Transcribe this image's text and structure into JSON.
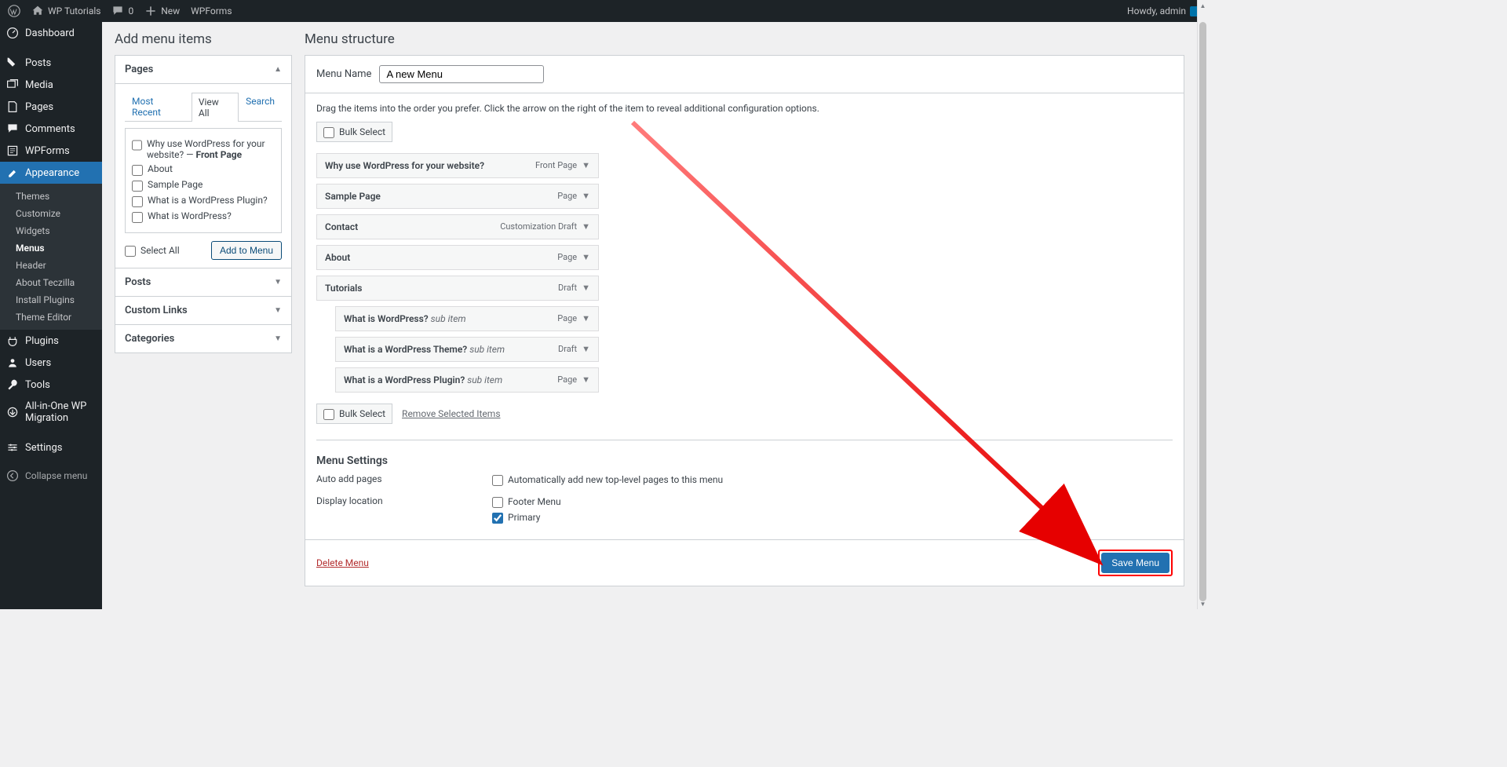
{
  "adminbar": {
    "site": "WP Tutorials",
    "comments": "0",
    "new": "New",
    "wpforms": "WPForms",
    "howdy": "Howdy, admin"
  },
  "sidebar": {
    "items": [
      {
        "id": "dashboard",
        "label": "Dashboard"
      },
      {
        "id": "posts",
        "label": "Posts"
      },
      {
        "id": "media",
        "label": "Media"
      },
      {
        "id": "pages",
        "label": "Pages"
      },
      {
        "id": "comments",
        "label": "Comments"
      },
      {
        "id": "wpforms",
        "label": "WPForms"
      },
      {
        "id": "appearance",
        "label": "Appearance"
      },
      {
        "id": "plugins",
        "label": "Plugins"
      },
      {
        "id": "users",
        "label": "Users"
      },
      {
        "id": "tools",
        "label": "Tools"
      },
      {
        "id": "aiowpm",
        "label": "All-in-One WP Migration"
      },
      {
        "id": "settings",
        "label": "Settings"
      }
    ],
    "sub_appearance": [
      {
        "label": "Themes"
      },
      {
        "label": "Customize"
      },
      {
        "label": "Widgets"
      },
      {
        "label": "Menus",
        "selected": true
      },
      {
        "label": "Header"
      },
      {
        "label": "About Teczilla"
      },
      {
        "label": "Install Plugins"
      },
      {
        "label": "Theme Editor"
      }
    ],
    "collapse": "Collapse menu"
  },
  "left": {
    "heading": "Add menu items",
    "pages_title": "Pages",
    "posts_title": "Posts",
    "custom_title": "Custom Links",
    "categories_title": "Categories",
    "tabs": {
      "recent": "Most Recent",
      "viewall": "View All",
      "search": "Search"
    },
    "page_options": [
      {
        "label_pre": "Why use WordPress for your website? — ",
        "label_strong": "Front Page"
      },
      {
        "label_pre": "About"
      },
      {
        "label_pre": "Sample Page"
      },
      {
        "label_pre": "What is a WordPress Plugin?"
      },
      {
        "label_pre": "What is WordPress?"
      }
    ],
    "select_all": "Select All",
    "add_to_menu": "Add to Menu"
  },
  "right": {
    "heading": "Menu structure",
    "menu_name_label": "Menu Name",
    "menu_name_value": "A new Menu",
    "instruction": "Drag the items into the order you prefer. Click the arrow on the right of the item to reveal additional configuration options.",
    "bulk_select": "Bulk Select",
    "items": [
      {
        "title": "Why use WordPress for your website?",
        "type": "Front Page",
        "indent": false
      },
      {
        "title": "Sample Page",
        "type": "Page",
        "indent": false
      },
      {
        "title": "Contact",
        "type": "Customization Draft",
        "indent": false
      },
      {
        "title": "About",
        "type": "Page",
        "indent": false
      },
      {
        "title": "Tutorials",
        "type": "Draft",
        "indent": false
      },
      {
        "title": "What is WordPress?",
        "sub": "sub item",
        "type": "Page",
        "indent": true
      },
      {
        "title": "What is a WordPress Theme?",
        "sub": "sub item",
        "type": "Draft",
        "indent": true
      },
      {
        "title": "What is a WordPress Plugin?",
        "sub": "sub item",
        "type": "Page",
        "indent": true
      }
    ],
    "remove_selected": "Remove Selected Items",
    "settings": {
      "heading": "Menu Settings",
      "auto_label": "Auto add pages",
      "auto_option": "Automatically add new top-level pages to this menu",
      "loc_label": "Display location",
      "loc_footer": "Footer Menu",
      "loc_primary": "Primary"
    },
    "delete_menu": "Delete Menu",
    "save_menu": "Save Menu"
  }
}
